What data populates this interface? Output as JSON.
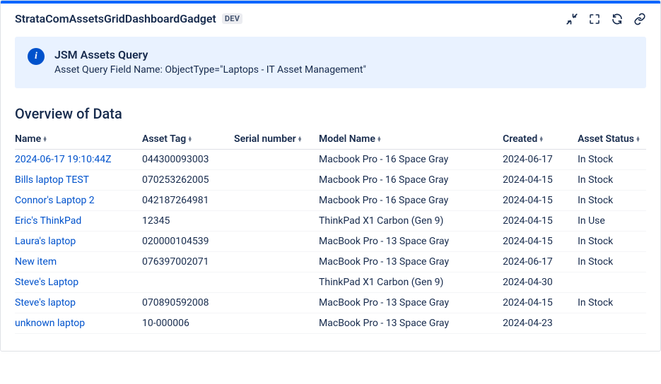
{
  "header": {
    "title": "StrataComAssetsGridDashboardGadget",
    "dev_label": "DEV"
  },
  "info_panel": {
    "title": "JSM Assets Query",
    "query_field_name_label": "Asset Query Field Name",
    "query_value": "ObjectType=\"Laptops - IT Asset Management\""
  },
  "section": {
    "heading": "Overview of Data"
  },
  "table": {
    "columns": [
      {
        "key": "name",
        "label": "Name",
        "sortable": true
      },
      {
        "key": "assetTag",
        "label": "Asset Tag",
        "sortable": true
      },
      {
        "key": "serialNumber",
        "label": "Serial number",
        "sortable": true
      },
      {
        "key": "modelName",
        "label": "Model Name",
        "sortable": true
      },
      {
        "key": "created",
        "label": "Created",
        "sortable": true
      },
      {
        "key": "assetStatus",
        "label": "Asset Status",
        "sortable": true
      }
    ],
    "rows": [
      {
        "name": "2024-06-17 19:10:44Z",
        "assetTag": "044300093003",
        "serialNumber": "",
        "modelName": "Macbook Pro - 16 Space Gray",
        "created": "2024-06-17",
        "assetStatus": "In Stock"
      },
      {
        "name": "Bills laptop TEST",
        "assetTag": "070253262005",
        "serialNumber": "",
        "modelName": "Macbook Pro - 16 Space Gray",
        "created": "2024-04-15",
        "assetStatus": "In Stock"
      },
      {
        "name": "Connor's Laptop 2",
        "assetTag": "042187264981",
        "serialNumber": "",
        "modelName": "Macbook Pro - 16 Space Gray",
        "created": "2024-04-15",
        "assetStatus": "In Stock"
      },
      {
        "name": "Eric's ThinkPad",
        "assetTag": "12345",
        "serialNumber": "",
        "modelName": "ThinkPad X1 Carbon (Gen 9)",
        "created": "2024-04-15",
        "assetStatus": "In Use"
      },
      {
        "name": "Laura's laptop",
        "assetTag": "020000104539",
        "serialNumber": "",
        "modelName": "MacBook Pro - 13 Space Gray",
        "created": "2024-04-15",
        "assetStatus": "In Stock"
      },
      {
        "name": "New item",
        "assetTag": "076397002071",
        "serialNumber": "",
        "modelName": "MacBook Pro - 13 Space Gray",
        "created": "2024-06-17",
        "assetStatus": "In Stock"
      },
      {
        "name": "Steve's Laptop",
        "assetTag": "",
        "serialNumber": "",
        "modelName": "ThinkPad X1 Carbon (Gen 9)",
        "created": "2024-04-30",
        "assetStatus": ""
      },
      {
        "name": "Steve's laptop",
        "assetTag": "070890592008",
        "serialNumber": "",
        "modelName": "MacBook Pro - 13 Space Gray",
        "created": "2024-04-15",
        "assetStatus": "In Stock"
      },
      {
        "name": "unknown laptop",
        "assetTag": "10-000006",
        "serialNumber": "",
        "modelName": "MacBook Pro - 13 Space Gray",
        "created": "2024-04-23",
        "assetStatus": ""
      }
    ]
  }
}
